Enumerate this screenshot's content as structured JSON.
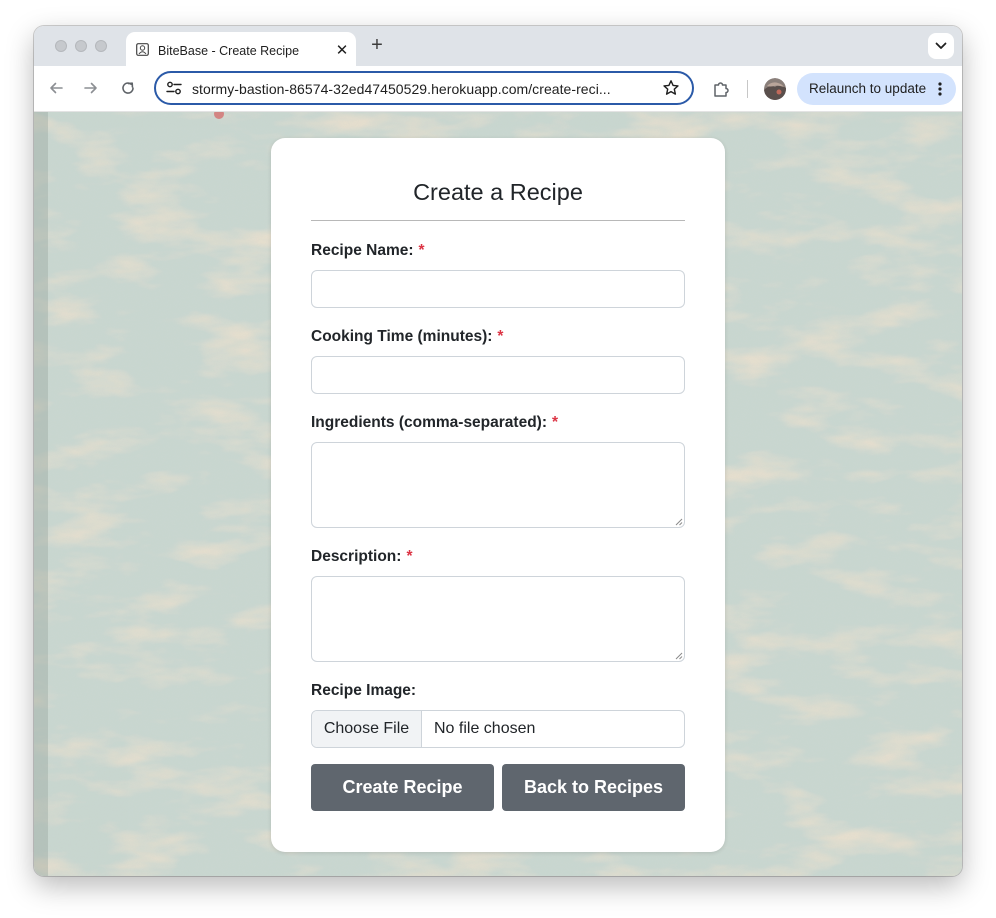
{
  "browser": {
    "tab_title": "BiteBase - Create Recipe",
    "tab_close_glyph": "✕",
    "new_tab_glyph": "+",
    "url": "stormy-bastion-86574-32ed47450529.herokuapp.com/create-reci...",
    "relaunch_label": "Relaunch to update",
    "icons": [
      "back-arrow-icon",
      "forward-arrow-icon",
      "reload-icon",
      "site-settings-icon",
      "bookmark-star-icon",
      "extensions-puzzle-icon",
      "profile-avatar",
      "more-menu-icon",
      "tab-search-chevron-icon"
    ]
  },
  "form": {
    "title": "Create a Recipe",
    "required_mark": "*",
    "fields": {
      "name": {
        "label": "Recipe Name:",
        "value": ""
      },
      "time": {
        "label": "Cooking Time (minutes):",
        "value": ""
      },
      "ingredients": {
        "label": "Ingredients (comma-separated):",
        "value": ""
      },
      "description": {
        "label": "Description:",
        "value": ""
      },
      "image": {
        "label": "Recipe Image:",
        "button_label": "Choose File",
        "status": "No file chosen"
      }
    },
    "buttons": {
      "create": "Create Recipe",
      "back": "Back to Recipes"
    }
  },
  "colors": {
    "accent_border": "#2b5aa8",
    "required": "#dc3545",
    "button_bg": "#5f666e",
    "relaunch_bg": "#d3e3fd"
  }
}
